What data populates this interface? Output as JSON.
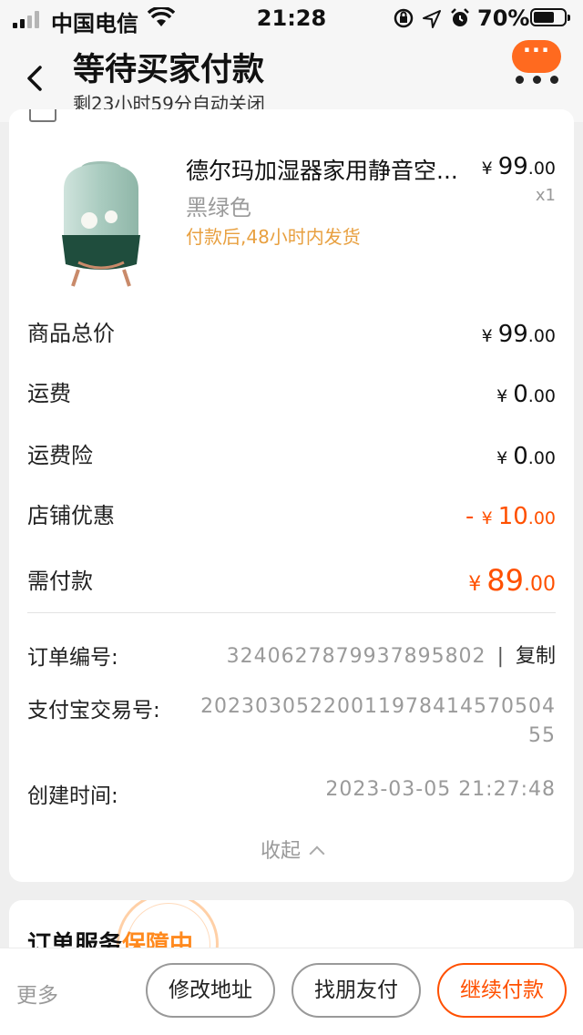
{
  "status_bar": {
    "carrier": "中国电信",
    "time": "21:28",
    "battery_percent": "70%"
  },
  "header": {
    "title": "等待买家付款",
    "countdown": "剩23小时59分自动关闭",
    "more_button": "···"
  },
  "product": {
    "name": "德尔玛加湿器家用静音空...",
    "variant": "黑绿色",
    "delivery": "付款后,48小时内发货",
    "price_currency": "¥",
    "price_int": "99",
    "price_dec": ".00",
    "quantity": "x1"
  },
  "fees": [
    {
      "label": "商品总价",
      "sign": "",
      "currency": "¥",
      "int": "99",
      "dec": ".00"
    },
    {
      "label": "运费",
      "sign": "",
      "currency": "¥",
      "int": "0",
      "dec": ".00"
    },
    {
      "label": "运费险",
      "sign": "",
      "currency": "¥",
      "int": "0",
      "dec": ".00"
    },
    {
      "label": "店铺优惠",
      "sign": "- ",
      "currency": "¥",
      "int": "10",
      "dec": ".00"
    }
  ],
  "total": {
    "label": "需付款",
    "currency": "¥",
    "int": "89",
    "dec": ".00"
  },
  "order_info": {
    "order_no_label": "订单编号:",
    "order_no": "3240627879937895802",
    "separator": "|",
    "copy_label": "复制",
    "alipay_label": "支付宝交易号:",
    "alipay_no": "2023030522001197841457050455",
    "created_label": "创建时间:",
    "created_time": "2023-03-05 21:27:48"
  },
  "collapse_label": "收起",
  "service": {
    "title": "订单服务",
    "status": "保障中"
  },
  "actions": {
    "more": "更多",
    "modify_address": "修改地址",
    "friend_pay": "找朋友付",
    "continue_pay": "继续付款"
  },
  "colors": {
    "accent": "#ff5000",
    "more_button_bg": "#ff6a1f",
    "delivery_note": "#e8a040",
    "service_status": "#ff8a1f"
  }
}
